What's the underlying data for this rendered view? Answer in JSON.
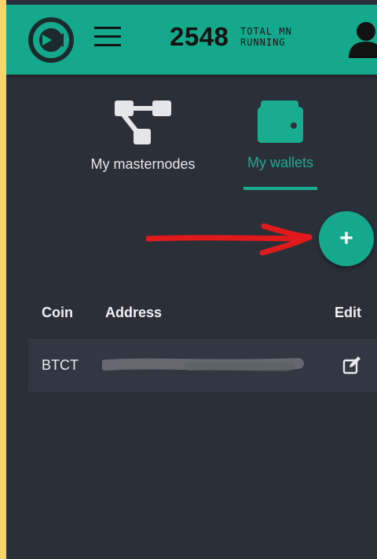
{
  "header": {
    "mn_count": "2548",
    "mn_label_line1": "TOTAL MN",
    "mn_label_line2": "RUNNING",
    "icons": {
      "logo": "app-logo",
      "menu": "hamburger-icon",
      "user": "user-icon"
    },
    "accent_color": "#14a88d"
  },
  "tabs": [
    {
      "label": "My masternodes",
      "icon": "nodes-icon",
      "active": false
    },
    {
      "label": "My wallets",
      "icon": "wallet-icon",
      "active": true
    }
  ],
  "fab": {
    "label": "+"
  },
  "table": {
    "headers": {
      "coin": "Coin",
      "address": "Address",
      "edit": "Edit"
    },
    "rows": [
      {
        "coin": "BTCT",
        "address_redacted": true
      }
    ]
  }
}
